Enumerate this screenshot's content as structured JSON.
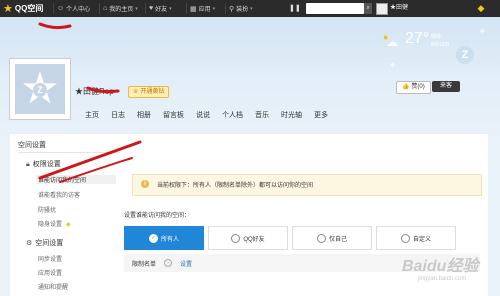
{
  "topbar": {
    "logo_text": "QQ空间",
    "nav": [
      {
        "label": "个人中心",
        "icon": "person-icon"
      },
      {
        "label": "我的主页",
        "icon": "home-icon"
      },
      {
        "label": "好友",
        "icon": "friends-icon"
      },
      {
        "label": "应用",
        "icon": "apps-icon"
      },
      {
        "label": "装扮",
        "icon": "shirt-icon"
      }
    ],
    "user_name": "★田健"
  },
  "weather": {
    "temp": "27°",
    "condition": "晴转",
    "date": "8月13日"
  },
  "profile": {
    "username": "★田健Rop",
    "vip_badge": "开通黄钻",
    "like_button": "赞(0)",
    "visitor_button": "来客",
    "tabs": [
      "主页",
      "日志",
      "相册",
      "留言板",
      "说说",
      "个人档",
      "音乐",
      "时光轴",
      "更多"
    ]
  },
  "panel": {
    "title": "空间设置",
    "groups": [
      {
        "label": "权限设置",
        "icon": "lock-icon",
        "items": [
          "谁能访问我的空间",
          "谁能看我的访客",
          "防骚扰",
          "隐身设置"
        ]
      },
      {
        "label": "空间设置",
        "icon": "gear-icon",
        "items": [
          "同步设置",
          "应用设置",
          "通知和提醒"
        ]
      }
    ],
    "notice": "当前权限下：所有人（限制名单除外）都可以访问你的空间",
    "setting_label": "设置谁能访问我的空间：",
    "options": [
      "所有人",
      "QQ好友",
      "仅自己",
      "自定义"
    ],
    "selected_option": "所有人",
    "blacklist_label": "限制名单",
    "blacklist_link": "设置"
  },
  "watermark": {
    "text": "Baidu经验",
    "sub": "jingyan.baidu.com"
  },
  "colors": {
    "accent": "#1f86d8",
    "topbar": "#2b2b2b",
    "vip": "#e8b84a"
  }
}
